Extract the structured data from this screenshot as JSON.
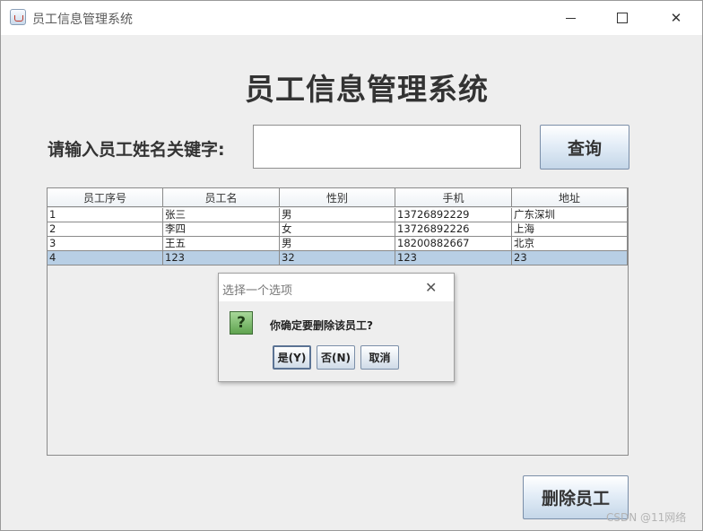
{
  "window": {
    "title": "员工信息管理系统",
    "minimize_glyph": "",
    "maximize_glyph": "",
    "close_glyph": "✕"
  },
  "header": {
    "title": "员工信息管理系统"
  },
  "search": {
    "label": "请输入员工姓名关键字:",
    "value": "",
    "button_label": "查询"
  },
  "table": {
    "columns": [
      "员工序号",
      "员工名",
      "性别",
      "手机",
      "地址"
    ],
    "rows": [
      [
        "1",
        "张三",
        "男",
        "13726892229",
        "广东深圳"
      ],
      [
        "2",
        "李四",
        "女",
        "13726892226",
        "上海"
      ],
      [
        "3",
        "王五",
        "男",
        "18200882667",
        "北京"
      ],
      [
        "4",
        "123",
        "32",
        "123",
        "23"
      ]
    ],
    "selected_row": 3
  },
  "dialog": {
    "title": "选择一个选项",
    "message": "你确定要删除该员工?",
    "icon": "question-icon",
    "icon_glyph": "?",
    "close_glyph": "✕",
    "buttons": {
      "yes": "是(Y)",
      "no": "否(N)",
      "cancel": "取消"
    }
  },
  "footer": {
    "delete_button_label": "删除员工"
  },
  "watermark": "CSDN @11网络",
  "colors": {
    "selected_row": "#b8cfe5",
    "button_gradient_end": "#c4d6e8",
    "question_icon": "#5fa34f"
  }
}
